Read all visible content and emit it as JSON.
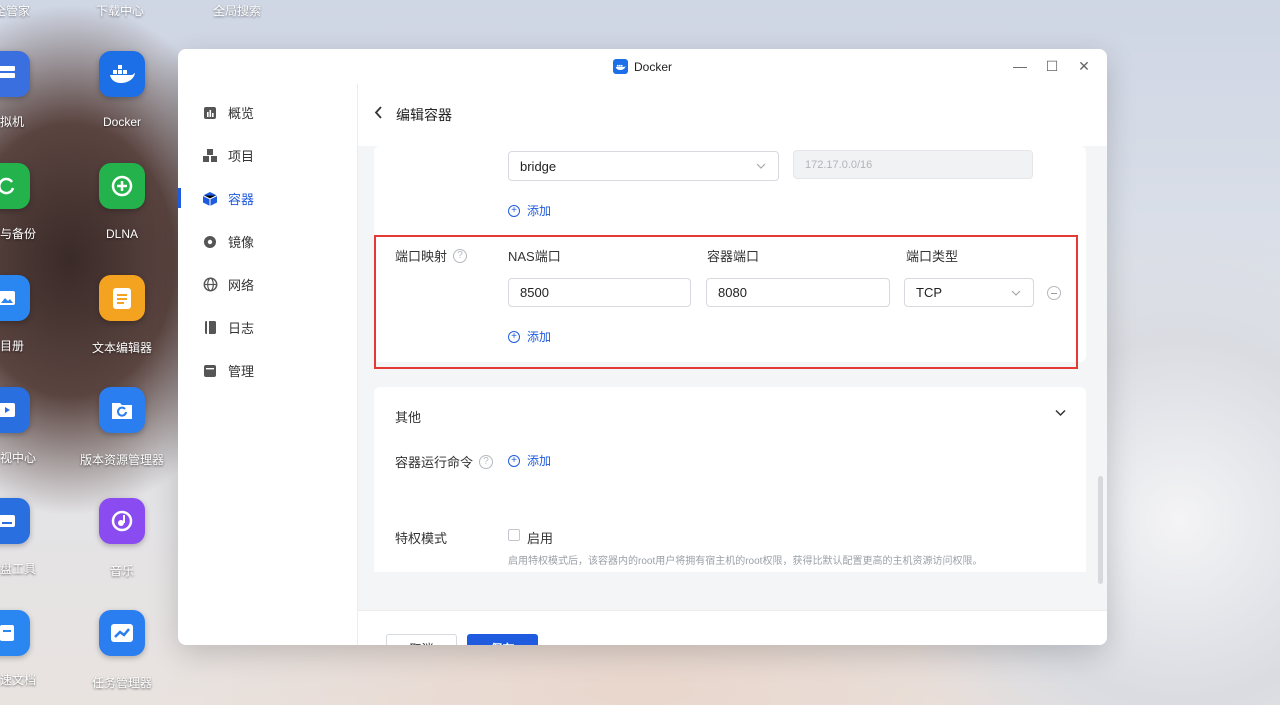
{
  "desktop": {
    "top_labels": [
      "全管家",
      "下载中心",
      "全局搜索"
    ],
    "icons": [
      {
        "label": "Docker",
        "color": "#1d6fe8"
      },
      {
        "label": "DLNA",
        "color": "#23b24b"
      },
      {
        "label": "文本编辑器",
        "color": "#f4a320"
      },
      {
        "label": "版本资源管理器",
        "color": "#2a7ef0"
      },
      {
        "label": "音乐",
        "color": "#8a4cf0"
      },
      {
        "label": "任务管理器",
        "color": "#2a7ef0"
      }
    ],
    "edge_icons": [
      {
        "label": "拟机",
        "color": "#3a6fe0"
      },
      {
        "label": "与备份",
        "color": "#23b24b"
      },
      {
        "label": "目册",
        "color": "#2a86f0"
      },
      {
        "label": "视中心",
        "color": "#2a6fe0"
      },
      {
        "label": "盘工具",
        "color": "#2a6fe0"
      },
      {
        "label": "速文档",
        "color": "#2a86f0"
      }
    ]
  },
  "window": {
    "title": "Docker",
    "controls": {
      "minimize": "—",
      "maximize": "☐",
      "close": "✕"
    }
  },
  "sidebar": {
    "items": [
      {
        "label": "概览",
        "icon": "overview-icon"
      },
      {
        "label": "项目",
        "icon": "project-icon"
      },
      {
        "label": "容器",
        "icon": "container-icon",
        "active": true
      },
      {
        "label": "镜像",
        "icon": "image-icon"
      },
      {
        "label": "网络",
        "icon": "network-icon"
      },
      {
        "label": "日志",
        "icon": "log-icon"
      },
      {
        "label": "管理",
        "icon": "manage-icon"
      }
    ]
  },
  "header": {
    "back": "‹",
    "title": "编辑容器"
  },
  "network": {
    "mode": "bridge",
    "subnet_placeholder": "172.17.0.0/16",
    "add_label": "添加"
  },
  "port_mapping": {
    "label": "端口映射",
    "help": "?",
    "col_nas": "NAS端口",
    "col_container": "容器端口",
    "col_type": "端口类型",
    "rows": [
      {
        "nas_port": "8500",
        "container_port": "8080",
        "type": "TCP"
      }
    ],
    "add_label": "添加"
  },
  "other": {
    "title": "其他",
    "run_command_label": "容器运行命令",
    "run_command_add": "添加",
    "privileged_label": "特权模式",
    "privileged_option": "启用",
    "privileged_hint": "启用特权模式后，该容器内的root用户将拥有宿主机的root权限，获得比默认配置更高的主机资源访问权限。"
  },
  "footer": {
    "cancel": "取消",
    "save": "保存"
  },
  "colors": {
    "accent": "#1f5bde",
    "highlight": "#e53935"
  }
}
